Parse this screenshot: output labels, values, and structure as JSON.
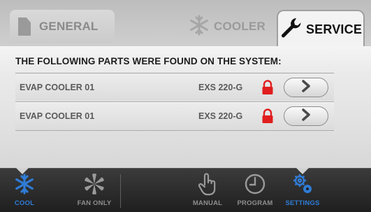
{
  "tabs": {
    "general": {
      "label": "GENERAL",
      "icon": "document-icon"
    },
    "cooler": {
      "label": "COOLER",
      "icon": "snowflake-icon"
    },
    "service": {
      "label": "SERVICE",
      "icon": "wrench-icon",
      "active": true
    }
  },
  "content": {
    "heading": "THE FOLLOWING PARTS WERE FOUND ON THE SYSTEM:",
    "parts": [
      {
        "name": "EVAP COOLER 01",
        "model": "EXS 220-G",
        "locked": true
      },
      {
        "name": "EVAP COOLER 01",
        "model": "EXS 220-G",
        "locked": true
      }
    ]
  },
  "nav": {
    "cool": {
      "label": "COOL",
      "icon": "snowflake-icon",
      "active": true
    },
    "fan_only": {
      "label": "FAN ONLY",
      "icon": "fan-icon"
    },
    "manual": {
      "label": "MANUAL",
      "icon": "hand-pointer-icon"
    },
    "program": {
      "label": "PROGRAM",
      "icon": "clock-icon"
    },
    "settings": {
      "label": "SETTINGS",
      "icon": "gears-icon",
      "active": true
    }
  },
  "colors": {
    "accent": "#2f7cd6",
    "lock": "#e01e1e",
    "inactive_text": "#8e8e8e"
  }
}
